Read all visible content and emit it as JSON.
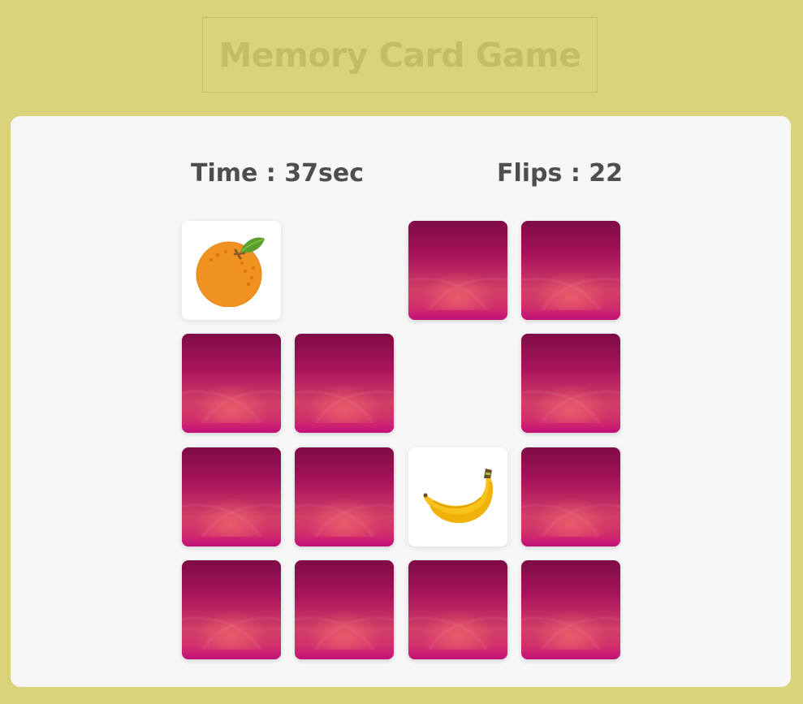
{
  "title": "Memory Card Game",
  "stats": {
    "time_label": "Time : 37sec",
    "flips_label": "Flips : 22"
  },
  "colors": {
    "background": "#dbd27c",
    "panel": "#f7f7f7",
    "card_back": "#a8145c",
    "text": "#4e4e4e"
  },
  "cards": [
    {
      "state": "flipped",
      "icon": "orange-icon"
    },
    {
      "state": "matched"
    },
    {
      "state": "hidden"
    },
    {
      "state": "hidden"
    },
    {
      "state": "hidden"
    },
    {
      "state": "hidden"
    },
    {
      "state": "matched"
    },
    {
      "state": "hidden"
    },
    {
      "state": "hidden"
    },
    {
      "state": "hidden"
    },
    {
      "state": "flipped",
      "icon": "banana-icon"
    },
    {
      "state": "hidden"
    },
    {
      "state": "hidden"
    },
    {
      "state": "hidden"
    },
    {
      "state": "hidden"
    },
    {
      "state": "hidden"
    }
  ]
}
